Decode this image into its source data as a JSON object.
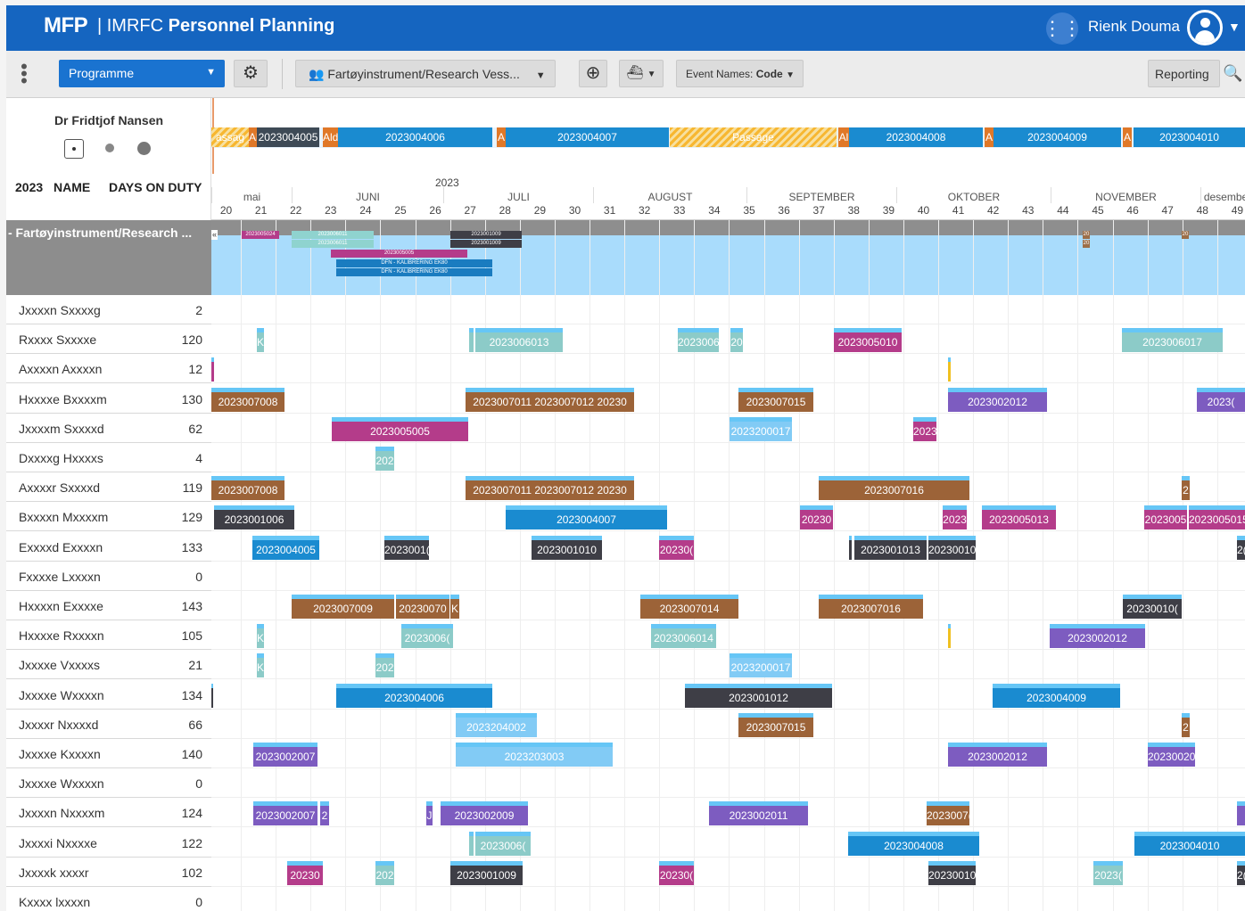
{
  "header": {
    "logo": "MFP",
    "app_title_prefix": "| IMRFC",
    "app_title_bold": "Personnel Planning",
    "user_name": "Rienk Douma"
  },
  "toolbar": {
    "programme": "Programme",
    "fartoy": "Fartøyinstrument/Research Vess...",
    "event_names": "Event Names:",
    "event_names_value": "Code",
    "reporting": "Reporting"
  },
  "vessel": {
    "name": "Dr Fridtjof Nansen"
  },
  "columns": {
    "year": "2023",
    "name": "NAME",
    "days": "DAYS ON DUTY"
  },
  "group": {
    "label": "- Fartøyinstrument/Research ..."
  },
  "timeline": {
    "year": "2023",
    "months": [
      "mai",
      "JUNI",
      "JULI",
      "AUGUST",
      "SEPTEMBER",
      "OKTOBER",
      "NOVEMBER",
      "desember"
    ],
    "weeks": [
      "20",
      "21",
      "22",
      "23",
      "24",
      "25",
      "26",
      "27",
      "28",
      "29",
      "30",
      "31",
      "32",
      "33",
      "34",
      "35",
      "36",
      "37",
      "38",
      "39",
      "40",
      "41",
      "42",
      "43",
      "44",
      "45",
      "46",
      "47",
      "48",
      "49"
    ]
  },
  "vessel_events": [
    {
      "l": 0,
      "w": 42,
      "c": "hat",
      "t": "assag"
    },
    {
      "l": 42,
      "w": 9,
      "c": "#e07828",
      "t": "Al"
    },
    {
      "l": 51,
      "w": 70,
      "c": "#3e4a56",
      "t": "2023004005"
    },
    {
      "l": 125,
      "w": 17,
      "c": "#e07828",
      "t": "Ald"
    },
    {
      "l": 142,
      "w": 173,
      "c": "#1a8bd0",
      "t": "2023004006"
    },
    {
      "l": 320,
      "w": 10,
      "c": "#e07828",
      "t": "A"
    },
    {
      "l": 330,
      "w": 183,
      "c": "#1a8bd0",
      "t": "2023004007"
    },
    {
      "l": 514,
      "w": 187,
      "c": "hat",
      "t": "Passage"
    },
    {
      "l": 703,
      "w": 12,
      "c": "#e07828",
      "t": "Al"
    },
    {
      "l": 715,
      "w": 150,
      "c": "#1a8bd0",
      "t": "2023004008"
    },
    {
      "l": 867,
      "w": 10,
      "c": "#e07828",
      "t": "A"
    },
    {
      "l": 877,
      "w": 143,
      "c": "#1a8bd0",
      "t": "2023004009"
    },
    {
      "l": 1022,
      "w": 10,
      "c": "#e07828",
      "t": "A"
    },
    {
      "l": 1034,
      "w": 125,
      "c": "#1a8bd0",
      "t": "2023004010"
    }
  ],
  "group_events": [
    {
      "l": 34,
      "t": 12,
      "w": 42,
      "c": "#b43c8a",
      "txt": "2023005024"
    },
    {
      "l": 90,
      "t": 12,
      "w": 92,
      "c": "#8fd3cf",
      "txt": "2023006011"
    },
    {
      "l": 90,
      "t": 22,
      "w": 92,
      "c": "#8fd3cf",
      "txt": "2023006011"
    },
    {
      "l": 268,
      "t": 12,
      "w": 80,
      "c": "#3e3e46",
      "txt": "2023001009"
    },
    {
      "l": 268,
      "t": 22,
      "w": 80,
      "c": "#3e3e46",
      "txt": "2023001009"
    },
    {
      "l": 134,
      "t": 33,
      "w": 153,
      "c": "#b43c8a",
      "txt": "2023005005"
    },
    {
      "l": 140,
      "t": 44,
      "w": 175,
      "c": "#1a7cc0",
      "txt": "DFN - KALIBRERING EK80"
    },
    {
      "l": 140,
      "t": 54,
      "w": 175,
      "c": "#1a7cc0",
      "txt": "DFN - KALIBRERING EK80"
    },
    {
      "l": 977,
      "t": 12,
      "w": 8,
      "c": "#9c6e48",
      "txt": "20"
    },
    {
      "l": 977,
      "t": 22,
      "w": 8,
      "c": "#9c6e48",
      "txt": "20"
    },
    {
      "l": 1088,
      "t": 12,
      "w": 8,
      "c": "#9c6e48",
      "txt": "20"
    }
  ],
  "people": [
    {
      "name": "Jxxxxn Sxxxxg",
      "days": "2",
      "bars": []
    },
    {
      "name": "Rxxxx Sxxxxe",
      "days": "120",
      "bars": [
        {
          "l": 51,
          "w": 8,
          "c": "#8ccbc8",
          "t": "K"
        },
        {
          "l": 289,
          "w": 5,
          "c": "#8ccbc8",
          "t": ""
        },
        {
          "l": 296,
          "w": 98,
          "c": "#8ccbc8",
          "t": "2023006013"
        },
        {
          "l": 523,
          "w": 46,
          "c": "#8ccbc8",
          "t": "2023006"
        },
        {
          "l": 582,
          "w": 14,
          "c": "#8ccbc8",
          "t": "20"
        },
        {
          "l": 698,
          "w": 76,
          "c": "#b43c8a",
          "t": "2023005010"
        },
        {
          "l": 1021,
          "w": 113,
          "c": "#8ccbc8",
          "t": "2023006017"
        }
      ]
    },
    {
      "name": "Axxxxn Axxxxn",
      "days": "12",
      "bars": [
        {
          "l": 0,
          "w": 3,
          "c": "#b43c8a",
          "t": ""
        },
        {
          "l": 826,
          "w": 3,
          "c": "#f0c020",
          "t": ""
        }
      ]
    },
    {
      "name": "Hxxxxe Bxxxxm",
      "days": "130",
      "bars": [
        {
          "l": 0,
          "w": 82,
          "c": "#9c6338",
          "t": "2023007008"
        },
        {
          "l": 285,
          "w": 189,
          "c": "#9c6338",
          "t": "2023007011  2023007012  20230"
        },
        {
          "l": 591,
          "w": 84,
          "c": "#9c6338",
          "t": "2023007015"
        },
        {
          "l": 826,
          "w": 111,
          "c": "#7d5cc0",
          "t": "2023002012"
        },
        {
          "l": 1105,
          "w": 54,
          "c": "#7d5cc0",
          "t": "2023("
        }
      ]
    },
    {
      "name": "Jxxxxm Sxxxxd",
      "days": "62",
      "bars": [
        {
          "l": 135,
          "w": 153,
          "c": "#b43c8a",
          "t": "2023005005"
        },
        {
          "l": 581,
          "w": 70,
          "c": "#82cbf5",
          "t": "2023200017"
        },
        {
          "l": 787,
          "w": 26,
          "c": "#b43c8a",
          "t": "2023"
        }
      ]
    },
    {
      "name": "Dxxxxg Hxxxxs",
      "days": "4",
      "bars": [
        {
          "l": 184,
          "w": 21,
          "c": "#8ccbc8",
          "t": "202"
        }
      ]
    },
    {
      "name": "Axxxxr Sxxxxd",
      "days": "119",
      "bars": [
        {
          "l": 0,
          "w": 82,
          "c": "#9c6338",
          "t": "2023007008"
        },
        {
          "l": 285,
          "w": 189,
          "c": "#9c6338",
          "t": "2023007011  2023007012  20230"
        },
        {
          "l": 681,
          "w": 169,
          "c": "#9c6338",
          "t": "2023007016"
        },
        {
          "l": 1088,
          "w": 9,
          "c": "#9c6338",
          "t": "2"
        }
      ]
    },
    {
      "name": "Bxxxxn Mxxxxm",
      "days": "129",
      "bars": [
        {
          "l": 3,
          "w": 90,
          "c": "#3e3e46",
          "t": "2023001006"
        },
        {
          "l": 330,
          "w": 181,
          "c": "#1a8bd0",
          "t": "2023004007"
        },
        {
          "l": 660,
          "w": 37,
          "c": "#b43c8a",
          "t": "20230"
        },
        {
          "l": 820,
          "w": 27,
          "c": "#b43c8a",
          "t": "2023"
        },
        {
          "l": 864,
          "w": 83,
          "c": "#b43c8a",
          "t": "2023005013"
        },
        {
          "l": 1046,
          "w": 48,
          "c": "#b43c8a",
          "t": "2023005"
        },
        {
          "l": 1096,
          "w": 63,
          "c": "#b43c8a",
          "t": "2023005015"
        }
      ]
    },
    {
      "name": "Exxxxd Exxxxn",
      "days": "133",
      "bars": [
        {
          "l": 46,
          "w": 75,
          "c": "#1a8bd0",
          "t": "2023004005"
        },
        {
          "l": 194,
          "w": 50,
          "c": "#3e3e46",
          "t": "2023001("
        },
        {
          "l": 359,
          "w": 79,
          "c": "#3e3e46",
          "t": "2023001010"
        },
        {
          "l": 502,
          "w": 39,
          "c": "#b43c8a",
          "t": "20230("
        },
        {
          "l": 715,
          "w": 3,
          "c": "#3e3e46",
          "t": ""
        },
        {
          "l": 721,
          "w": 81,
          "c": "#3e3e46",
          "t": "2023001013"
        },
        {
          "l": 804,
          "w": 53,
          "c": "#3e3e46",
          "t": "20230010"
        },
        {
          "l": 1150,
          "w": 9,
          "c": "#3e3e46",
          "t": "2("
        }
      ]
    },
    {
      "name": "Fxxxxe Lxxxxn",
      "days": "0",
      "bars": []
    },
    {
      "name": "Hxxxxn Exxxxe",
      "days": "143",
      "bars": [
        {
          "l": 90,
          "w": 115,
          "c": "#9c6338",
          "t": "2023007009"
        },
        {
          "l": 207,
          "w": 60,
          "c": "#9c6338",
          "t": "20230070"
        },
        {
          "l": 268,
          "w": 10,
          "c": "#9c6338",
          "t": "K"
        },
        {
          "l": 481,
          "w": 110,
          "c": "#9c6338",
          "t": "2023007014"
        },
        {
          "l": 681,
          "w": 117,
          "c": "#9c6338",
          "t": "2023007016"
        },
        {
          "l": 1022,
          "w": 66,
          "c": "#3e3e46",
          "t": "20230010("
        }
      ]
    },
    {
      "name": "Hxxxxe Rxxxxn",
      "days": "105",
      "bars": [
        {
          "l": 51,
          "w": 8,
          "c": "#8ccbc8",
          "t": "K"
        },
        {
          "l": 213,
          "w": 58,
          "c": "#8ccbc8",
          "t": "2023006("
        },
        {
          "l": 493,
          "w": 73,
          "c": "#8ccbc8",
          "t": "2023006014"
        },
        {
          "l": 826,
          "w": 3,
          "c": "#f0c020",
          "t": ""
        },
        {
          "l": 940,
          "w": 107,
          "c": "#7d5cc0",
          "t": "2023002012"
        }
      ]
    },
    {
      "name": "Jxxxxe Vxxxxs",
      "days": "21",
      "bars": [
        {
          "l": 51,
          "w": 8,
          "c": "#8ccbc8",
          "t": "K"
        },
        {
          "l": 184,
          "w": 21,
          "c": "#8ccbc8",
          "t": "202"
        },
        {
          "l": 581,
          "w": 70,
          "c": "#82cbf5",
          "t": "2023200017"
        }
      ]
    },
    {
      "name": "Jxxxxe Wxxxxn",
      "days": "134",
      "bars": [
        {
          "l": 0,
          "w": 2,
          "c": "#3e3e46",
          "t": ""
        },
        {
          "l": 140,
          "w": 175,
          "c": "#1a8bd0",
          "t": "2023004006"
        },
        {
          "l": 531,
          "w": 165,
          "c": "#3e3e46",
          "t": "2023001012"
        },
        {
          "l": 876,
          "w": 143,
          "c": "#1a8bd0",
          "t": "2023004009"
        }
      ]
    },
    {
      "name": "Jxxxxr Nxxxxd",
      "days": "66",
      "bars": [
        {
          "l": 274,
          "w": 91,
          "c": "#82cbf5",
          "t": "2023204002"
        },
        {
          "l": 591,
          "w": 84,
          "c": "#9c6338",
          "t": "2023007015"
        },
        {
          "l": 1088,
          "w": 9,
          "c": "#9c6338",
          "t": "2"
        }
      ]
    },
    {
      "name": "Jxxxxe Kxxxxn",
      "days": "140",
      "bars": [
        {
          "l": 47,
          "w": 72,
          "c": "#7d5cc0",
          "t": "2023002007"
        },
        {
          "l": 274,
          "w": 176,
          "c": "#82cbf5",
          "t": "2023203003"
        },
        {
          "l": 826,
          "w": 111,
          "c": "#7d5cc0",
          "t": "2023002012"
        },
        {
          "l": 1050,
          "w": 53,
          "c": "#7d5cc0",
          "t": "20230020"
        }
      ]
    },
    {
      "name": "Jxxxxe Wxxxxn",
      "days": "0",
      "bars": []
    },
    {
      "name": "Jxxxxn Nxxxxm",
      "days": "124",
      "bars": [
        {
          "l": 47,
          "w": 72,
          "c": "#7d5cc0",
          "t": "2023002007"
        },
        {
          "l": 122,
          "w": 10,
          "c": "#7d5cc0",
          "t": "2"
        },
        {
          "l": 241,
          "w": 7,
          "c": "#7d5cc0",
          "t": "J"
        },
        {
          "l": 257,
          "w": 98,
          "c": "#7d5cc0",
          "t": "2023002009"
        },
        {
          "l": 558,
          "w": 111,
          "c": "#7d5cc0",
          "t": "2023002011"
        },
        {
          "l": 802,
          "w": 48,
          "c": "#9c6338",
          "t": "2023007("
        },
        {
          "l": 1150,
          "w": 9,
          "c": "#7d5cc0",
          "t": ""
        }
      ]
    },
    {
      "name": "Jxxxxi Nxxxxe",
      "days": "122",
      "bars": [
        {
          "l": 289,
          "w": 5,
          "c": "#8ccbc8",
          "t": ""
        },
        {
          "l": 296,
          "w": 62,
          "c": "#8ccbc8",
          "t": "2023006("
        },
        {
          "l": 714,
          "w": 147,
          "c": "#1a8bd0",
          "t": "2023004008"
        },
        {
          "l": 1035,
          "w": 124,
          "c": "#1a8bd0",
          "t": "2023004010"
        }
      ]
    },
    {
      "name": "Jxxxxk xxxxr",
      "days": "102",
      "bars": [
        {
          "l": 85,
          "w": 40,
          "c": "#b43c8a",
          "t": "20230"
        },
        {
          "l": 184,
          "w": 21,
          "c": "#8ccbc8",
          "t": "202"
        },
        {
          "l": 268,
          "w": 81,
          "c": "#3e3e46",
          "t": "2023001009"
        },
        {
          "l": 502,
          "w": 39,
          "c": "#b43c8a",
          "t": "20230("
        },
        {
          "l": 804,
          "w": 53,
          "c": "#3e3e46",
          "t": "20230010"
        },
        {
          "l": 989,
          "w": 33,
          "c": "#8ccbc8",
          "t": "2023("
        },
        {
          "l": 1150,
          "w": 9,
          "c": "#3e3e46",
          "t": "2("
        }
      ]
    },
    {
      "name": "Kxxxx lxxxxn",
      "days": "0",
      "bars": []
    }
  ]
}
